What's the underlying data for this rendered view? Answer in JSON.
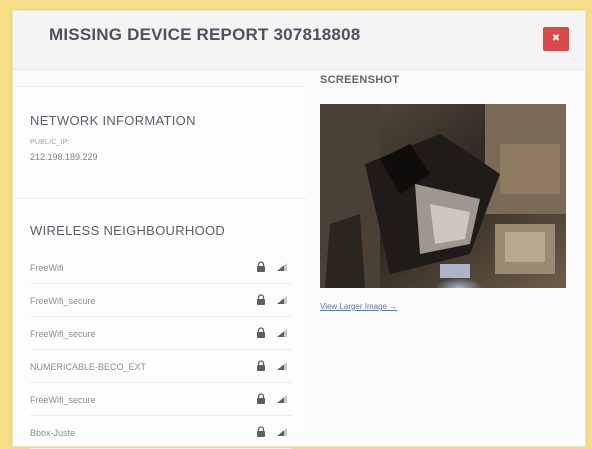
{
  "header": {
    "title": "MISSING DEVICE REPORT 307818808",
    "close_label": "✖"
  },
  "network": {
    "title": "NETWORK INFORMATION",
    "ip_label": "PUBLIC_IP:",
    "ip_value": "212.198.189.229"
  },
  "wireless": {
    "title": "WIRELESS NEIGHBOURHOOD",
    "networks": [
      {
        "name": "FreeWifi"
      },
      {
        "name": "FreeWifi_secure"
      },
      {
        "name": "FreeWifi_secure"
      },
      {
        "name": "NUMERICABLE-BECO_EXT"
      },
      {
        "name": "FreeWifi_secure"
      },
      {
        "name": "Bbox-Juste"
      }
    ]
  },
  "screenshot": {
    "title": "SCREENSHOT",
    "view_larger_label": "View Larger Image →"
  },
  "icons": {
    "lock": "lock-icon",
    "signal": "signal-icon",
    "close": "close-icon"
  },
  "colors": {
    "background": "#f7df8a",
    "close_button": "#dc4a47",
    "link": "#5c7bb0"
  }
}
